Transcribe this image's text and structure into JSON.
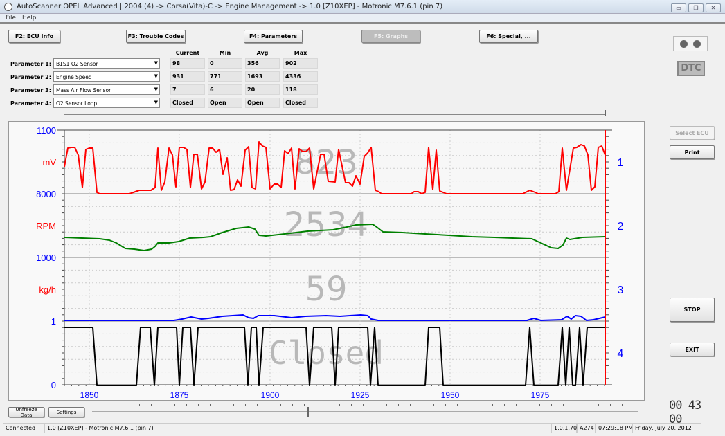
{
  "window": {
    "title": "AutoScanner OPEL Advanced | 2004 (4) -> Corsa(Vita)-C -> Engine Management -> 1.0 [Z10XEP] - Motronic M7.6.1 (pin 7)",
    "minimize": "▭",
    "restore": "❐",
    "close": "✕"
  },
  "menu": [
    "File",
    "Help"
  ],
  "tabs": [
    {
      "label": "F2: ECU Info"
    },
    {
      "label": "F3: Trouble Codes"
    },
    {
      "label": "F4: Parameters"
    },
    {
      "label": "F5: Graphs",
      "active": true
    },
    {
      "label": "F6: Special, ..."
    }
  ],
  "params": {
    "headers": [
      "Current",
      "Min",
      "Avg",
      "Max"
    ],
    "rows": [
      {
        "label": "Parameter 1:",
        "selected": "B1S1 O2 Sensor",
        "current": "98",
        "min": "0",
        "avg": "356",
        "max": "902"
      },
      {
        "label": "Parameter 2:",
        "selected": "Engine Speed",
        "current": "931",
        "min": "771",
        "avg": "1693",
        "max": "4336"
      },
      {
        "label": "Parameter 3:",
        "selected": "Mass Air Flow Sensor",
        "current": "7",
        "min": "6",
        "avg": "20",
        "max": "118"
      },
      {
        "label": "Parameter 4:",
        "selected": "O2 Sensor Loop",
        "current": "Closed",
        "min": "Open",
        "avg": "Open",
        "max": "Closed"
      }
    ]
  },
  "graph": {
    "left_labels": [
      "1100",
      "mV",
      "8000",
      "RPM",
      "1000",
      "kg/h",
      "1",
      "0"
    ],
    "right_labels": [
      "1",
      "2",
      "3",
      "4"
    ],
    "x_ticks": [
      "1850",
      "1875",
      "1900",
      "1925",
      "1950",
      "1975"
    ],
    "overlay_values": [
      "823",
      "2534",
      "59",
      "Closed"
    ],
    "colors": {
      "param1": "#ff0000",
      "param2": "#008000",
      "param3": "#0000ff",
      "param4": "#000000",
      "axis_label": "#0000ff",
      "unit_label": "#ff0000",
      "cursor": "#ff0000"
    }
  },
  "right_panel": {
    "dtc": "DTC",
    "select_ecu": "Select ECU",
    "print": "Print",
    "stop": "STOP",
    "exit": "EXIT",
    "timer": "00 43 00"
  },
  "bottom": {
    "unfreeze": "Unfreeze Data",
    "settings": "Settings"
  },
  "statusbar": [
    "Connected",
    "1.0 [Z10XEP] - Motronic M7.6.1 (pin 7)",
    "1,0,1,70",
    "A274",
    "07:29:18 PM",
    "Friday, July 20, 2012"
  ]
}
